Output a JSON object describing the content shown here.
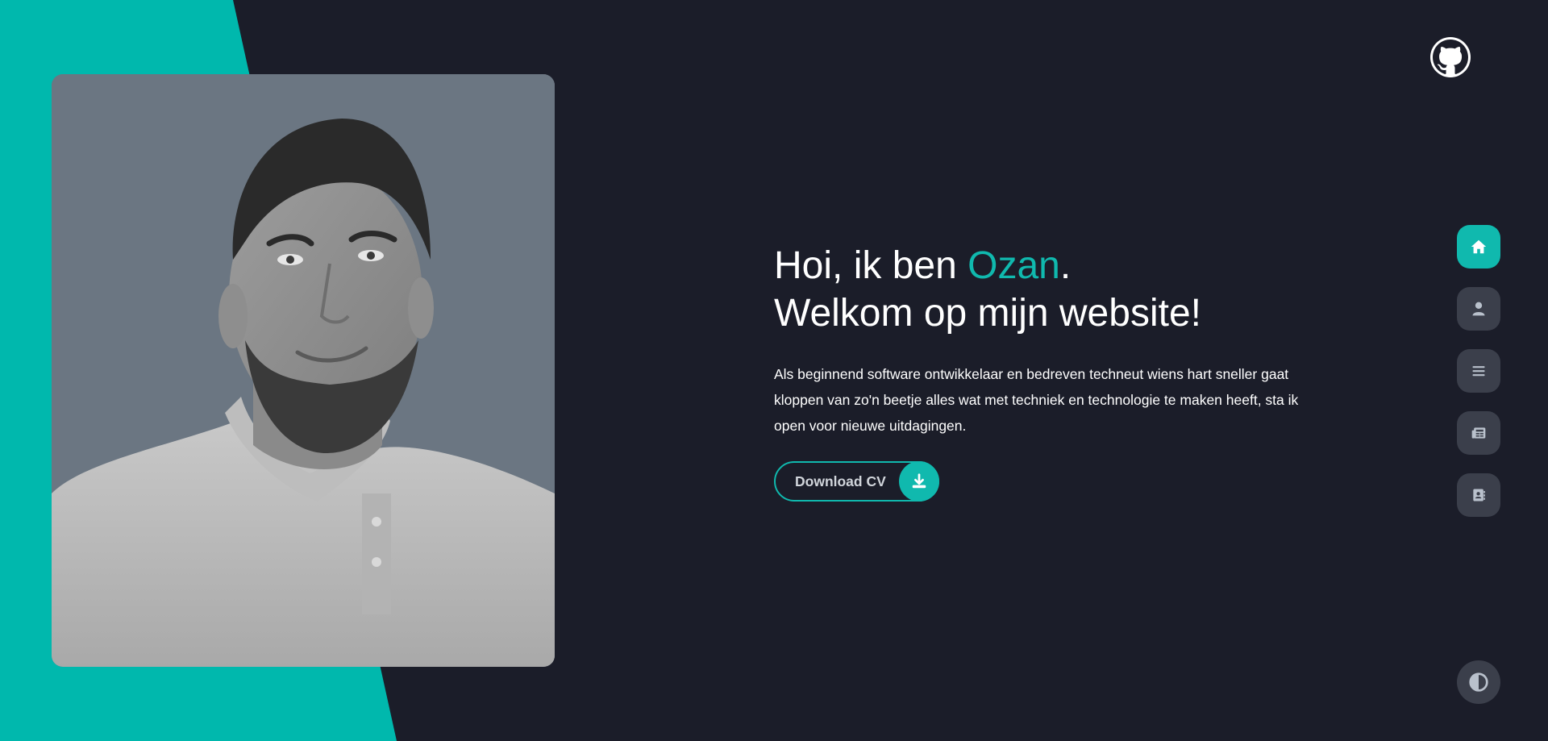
{
  "colors": {
    "accent": "#10b9ae",
    "background": "#1b1d29",
    "nav_button": "#3b3f4b",
    "icon_muted": "#b9c1cc"
  },
  "header": {
    "github_icon": "github-icon"
  },
  "hero": {
    "greeting_prefix": "Hoi, ik ben ",
    "name": "Ozan",
    "greeting_suffix": ".",
    "welcome": "Welkom op mijn website!",
    "intro": "Als beginnend software ontwikkelaar en bedreven techneut wiens hart sneller gaat kloppen van zo'n beetje alles wat met techniek en technologie te maken heeft, sta ik open voor nieuwe uitdagingen.",
    "download_label": "Download CV",
    "download_icon": "download-icon"
  },
  "nav": {
    "items": [
      {
        "icon": "home-icon",
        "active": true
      },
      {
        "icon": "user-icon",
        "active": false
      },
      {
        "icon": "menu-icon",
        "active": false
      },
      {
        "icon": "newspaper-icon",
        "active": false
      },
      {
        "icon": "contact-book-icon",
        "active": false
      }
    ]
  },
  "theme_toggle": {
    "icon": "contrast-icon"
  }
}
